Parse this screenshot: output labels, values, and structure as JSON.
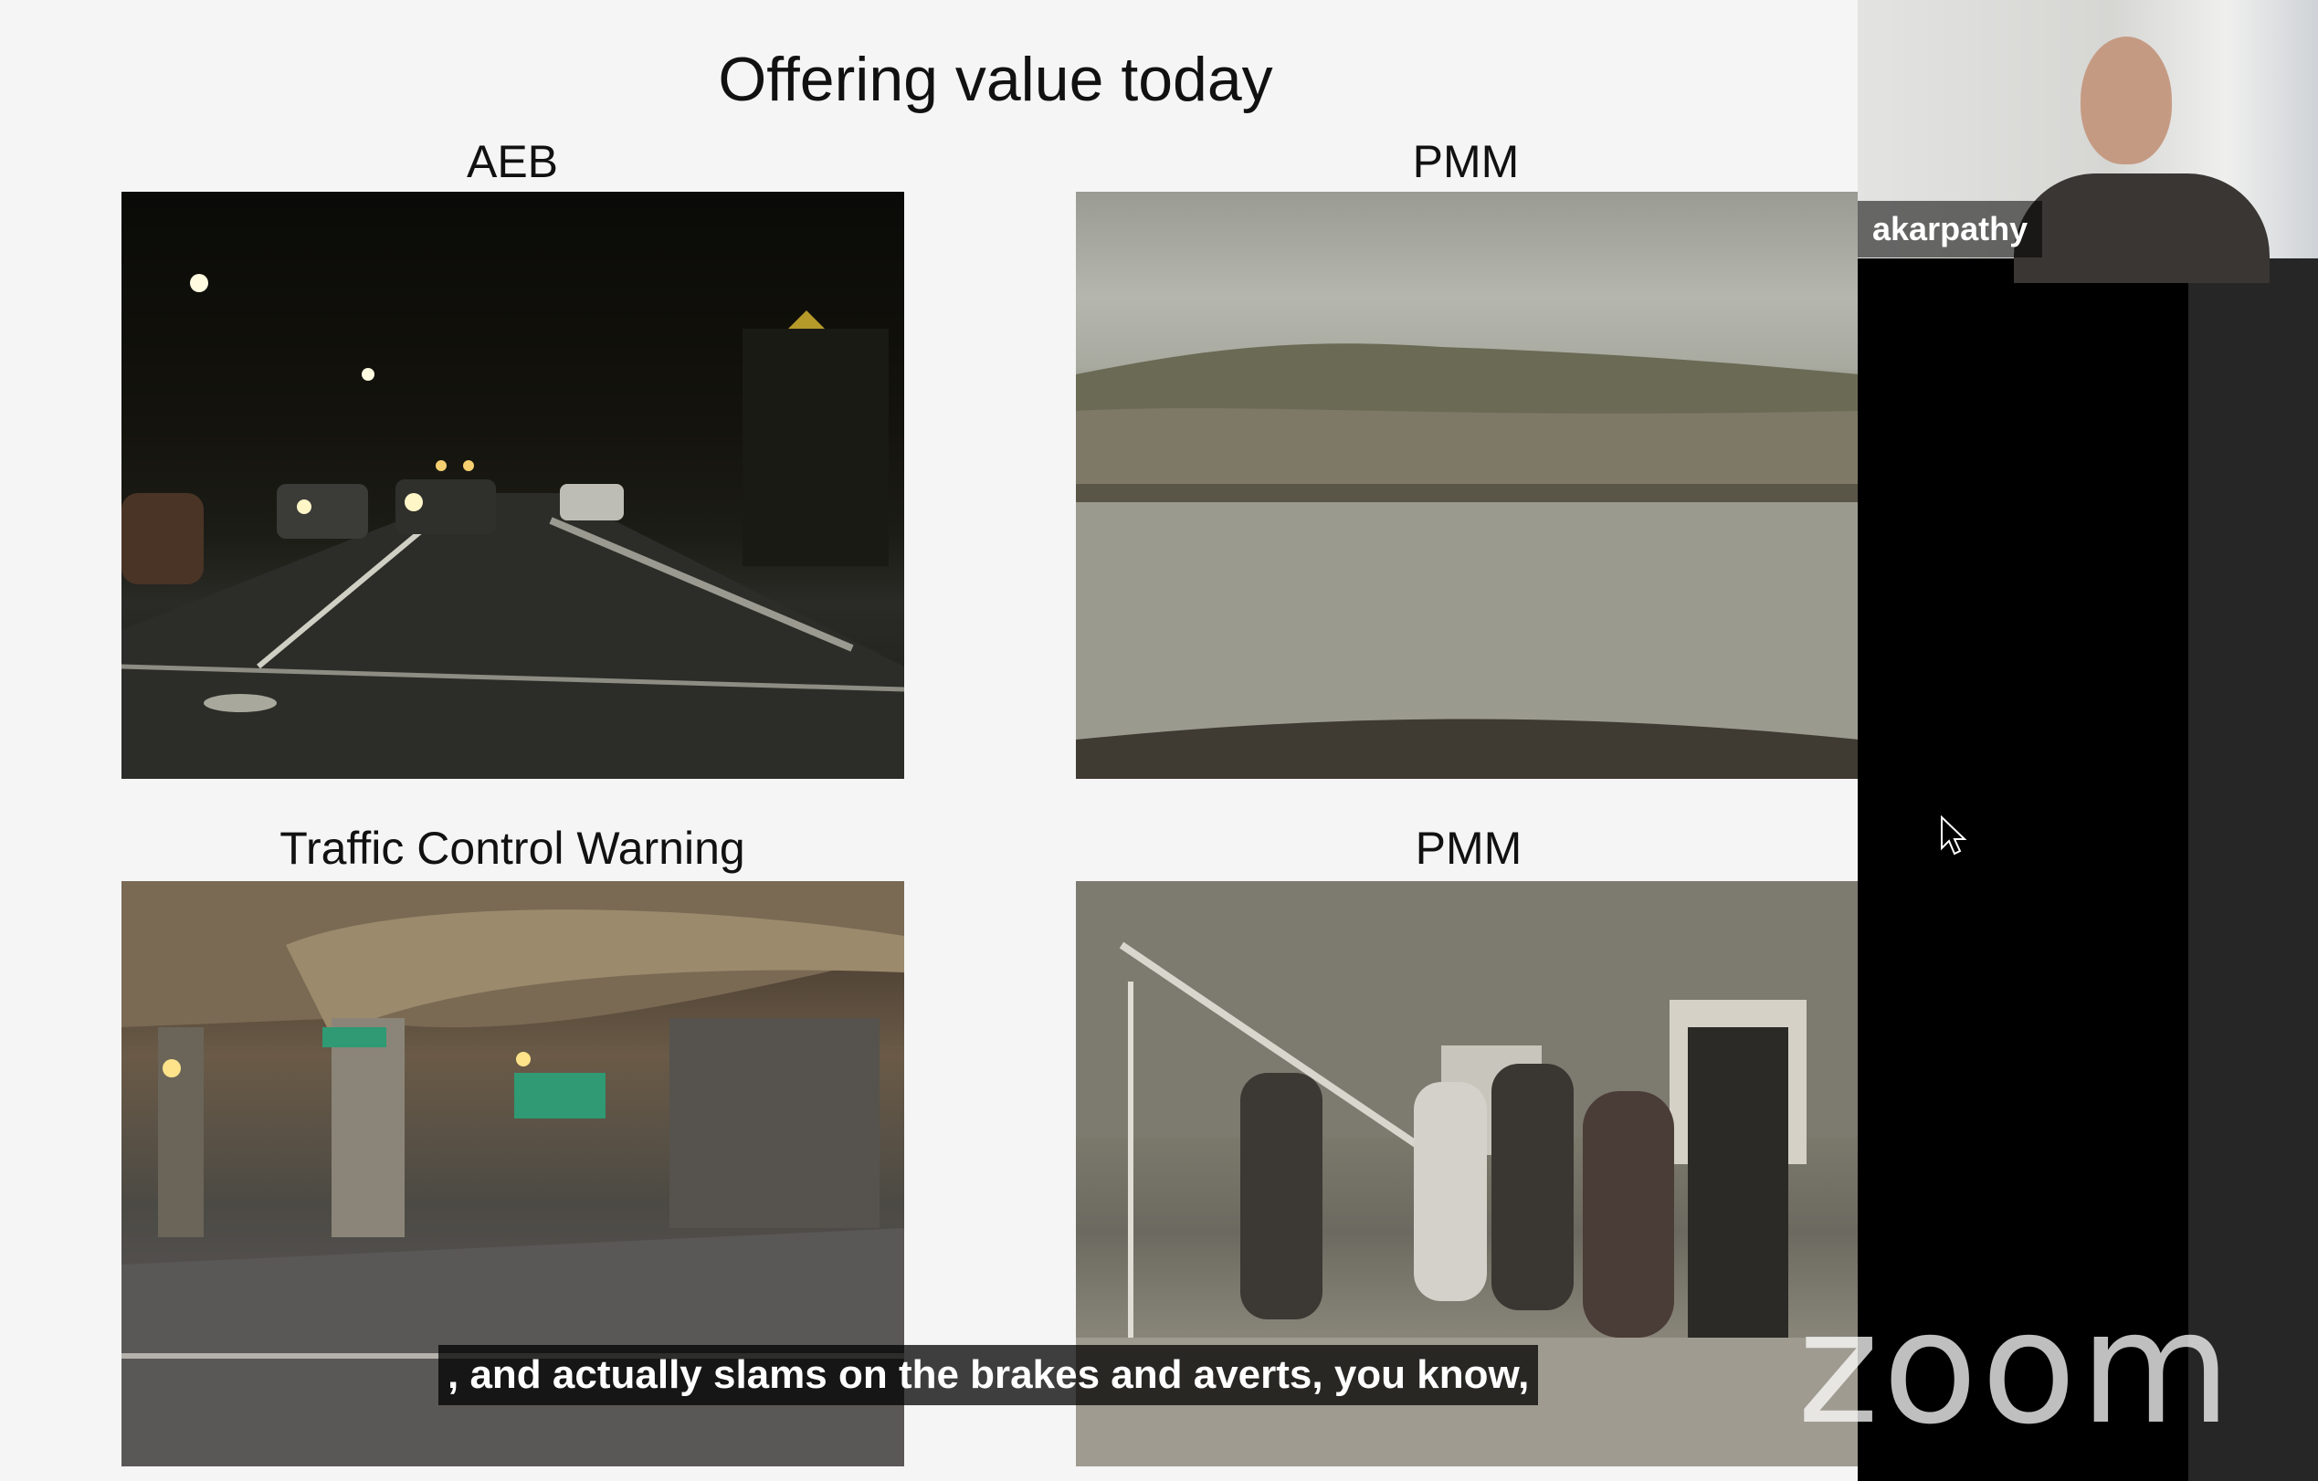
{
  "slide": {
    "title": "Offering value today",
    "panels": [
      {
        "label": "AEB"
      },
      {
        "label": "PMM"
      },
      {
        "label": "Traffic Control Warning"
      },
      {
        "label": "PMM"
      }
    ]
  },
  "participant": {
    "name": "akarpathy"
  },
  "caption": {
    "text": ", and actually slams on the brakes and averts, you know,"
  },
  "branding": {
    "logo_text": "zoom"
  }
}
